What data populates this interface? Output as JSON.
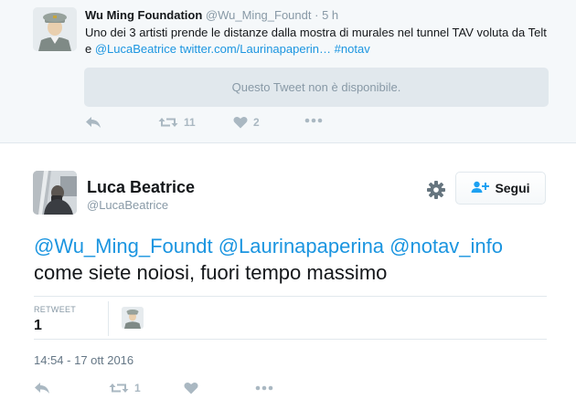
{
  "quoted_tweet": {
    "author_name": "Wu Ming Foundation",
    "author_handle": "@Wu_Ming_Foundt",
    "separator": "·",
    "time": "5 h",
    "text_plain": "Uno dei 3 artisti prende le distanze dalla mostra di murales nel tunnel TAV voluta da Telt e ",
    "text_mention": "@LucaBeatrice",
    "text_link": "twitter.com/Laurinapaperin…",
    "text_hashtag": "#notav",
    "unavailable_notice": "Questo Tweet non è disponibile.",
    "retweet_count": "11",
    "like_count": "2"
  },
  "main_tweet": {
    "author_name": "Luca Beatrice",
    "author_handle": "@LucaBeatrice",
    "follow_label": "Segui",
    "mentions": "@Wu_Ming_Foundt @Laurinapaperina @notav_info",
    "text": "come siete noiosi, fuori tempo massimo",
    "stats_label": "RETWEET",
    "stats_value": "1",
    "timestamp": "14:54 - 17 ott 2016",
    "retweet_count": "1"
  },
  "icons": [
    "reply-icon",
    "retweet-icon",
    "like-icon",
    "more-icon",
    "gear-icon",
    "follow-person-icon"
  ],
  "colors": {
    "link": "#1b95e0",
    "muted": "#8899a6",
    "icon": "#aab8c2",
    "background_alt": "#f5f8fa",
    "border": "#e1e8ed"
  }
}
